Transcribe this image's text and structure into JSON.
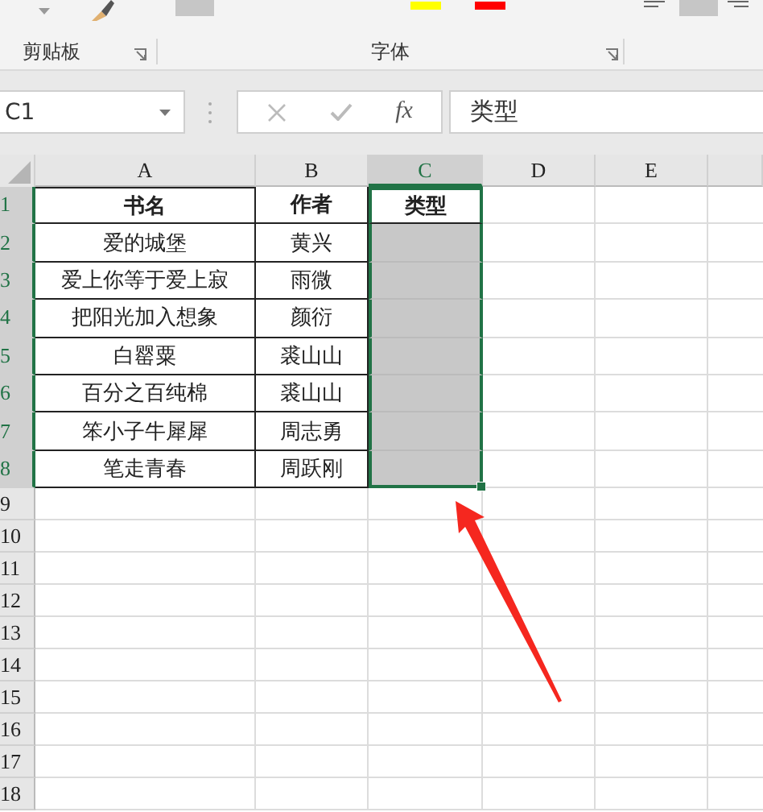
{
  "ribbon": {
    "groups": [
      {
        "label": "剪贴板"
      },
      {
        "label": "字体"
      }
    ]
  },
  "formula_bar": {
    "name_box": "C1",
    "function_label": "fx",
    "formula": "类型"
  },
  "columns": [
    {
      "label": "A",
      "selected": false
    },
    {
      "label": "B",
      "selected": false
    },
    {
      "label": "C",
      "selected": true
    },
    {
      "label": "D",
      "selected": false
    },
    {
      "label": "E",
      "selected": false
    }
  ],
  "rows": [
    {
      "number": "1",
      "selected": true,
      "kind": "header",
      "cells": [
        {
          "text": "书名",
          "selected": false
        },
        {
          "text": "作者",
          "selected": false
        },
        {
          "text": "类型",
          "selected": true,
          "active": true
        }
      ]
    },
    {
      "number": "2",
      "selected": true,
      "kind": "data",
      "cells": [
        {
          "text": "爱的城堡",
          "selected": false
        },
        {
          "text": "黄兴",
          "selected": false
        },
        {
          "selected": true,
          "active": false
        }
      ]
    },
    {
      "number": "3",
      "selected": true,
      "kind": "data",
      "cells": [
        {
          "text": "爱上你等于爱上寂",
          "selected": false
        },
        {
          "text": "雨微",
          "selected": false
        },
        {
          "selected": true,
          "active": false
        }
      ]
    },
    {
      "number": "4",
      "selected": true,
      "kind": "data",
      "cells": [
        {
          "text": "把阳光加入想象",
          "selected": false
        },
        {
          "text": "颜衍",
          "selected": false
        },
        {
          "selected": true,
          "active": false
        }
      ]
    },
    {
      "number": "5",
      "selected": true,
      "kind": "data",
      "cells": [
        {
          "text": "白罂粟",
          "selected": false
        },
        {
          "text": "裘山山",
          "selected": false
        },
        {
          "selected": true,
          "active": false
        }
      ]
    },
    {
      "number": "6",
      "selected": true,
      "kind": "data",
      "cells": [
        {
          "text": "百分之百纯棉",
          "selected": false
        },
        {
          "text": "裘山山",
          "selected": false
        },
        {
          "selected": true,
          "active": false
        }
      ]
    },
    {
      "number": "7",
      "selected": true,
      "kind": "data",
      "cells": [
        {
          "text": "笨小子牛犀犀",
          "selected": false
        },
        {
          "text": "周志勇",
          "selected": false
        },
        {
          "selected": true,
          "active": false
        }
      ]
    },
    {
      "number": "8",
      "selected": true,
      "kind": "data",
      "cells": [
        {
          "text": "笔走青春",
          "selected": false
        },
        {
          "text": "周跃刚",
          "selected": false
        },
        {
          "selected": true,
          "active": false
        }
      ]
    },
    {
      "number": "9",
      "selected": false,
      "kind": "empty"
    },
    {
      "number": "10",
      "selected": false,
      "kind": "empty"
    },
    {
      "number": "11",
      "selected": false,
      "kind": "empty"
    },
    {
      "number": "12",
      "selected": false,
      "kind": "empty"
    },
    {
      "number": "13",
      "selected": false,
      "kind": "empty"
    },
    {
      "number": "14",
      "selected": false,
      "kind": "empty"
    },
    {
      "number": "15",
      "selected": false,
      "kind": "empty"
    },
    {
      "number": "16",
      "selected": false,
      "kind": "empty"
    },
    {
      "number": "17",
      "selected": false,
      "kind": "empty"
    },
    {
      "number": "18",
      "selected": false,
      "kind": "empty"
    }
  ]
}
